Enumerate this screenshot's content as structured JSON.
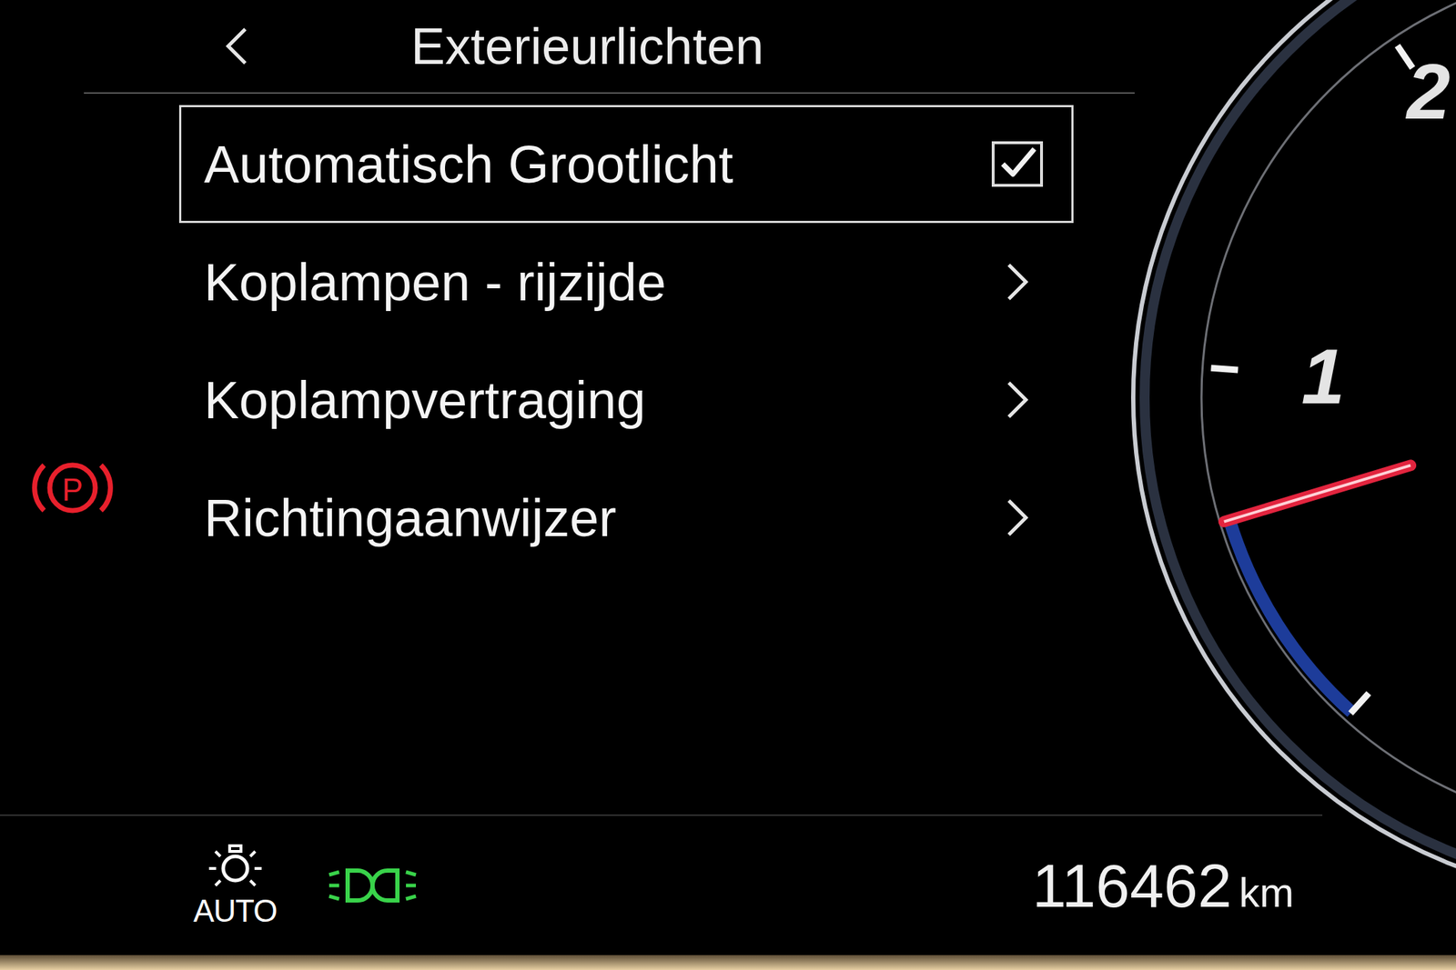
{
  "screen": {
    "title": "Exterieurlichten"
  },
  "menu": {
    "items": [
      {
        "label": "Automatisch Grootlicht",
        "kind": "checkbox",
        "checked": true,
        "selected": true
      },
      {
        "label": "Koplampen - rijzijde",
        "kind": "submenu",
        "selected": false
      },
      {
        "label": "Koplampvertraging",
        "kind": "submenu",
        "selected": false
      },
      {
        "label": "Richtingaanwijzer",
        "kind": "submenu",
        "selected": false
      }
    ]
  },
  "indicators": [
    {
      "kind": "parking-brake",
      "label": "P",
      "on": true,
      "color": "#e8202c"
    }
  ],
  "status_bar": {
    "lights": [
      {
        "kind": "auto-headlights",
        "label": "AUTO",
        "color": "#ffffff"
      },
      {
        "kind": "side-lights",
        "color": "#39d34a"
      }
    ],
    "odometer": {
      "value": "116462",
      "unit": "km"
    }
  },
  "tachometer": {
    "labels": [
      {
        "text": "1",
        "value": 1
      },
      {
        "text": "2",
        "value": 2
      }
    ],
    "needle": 0.6
  }
}
